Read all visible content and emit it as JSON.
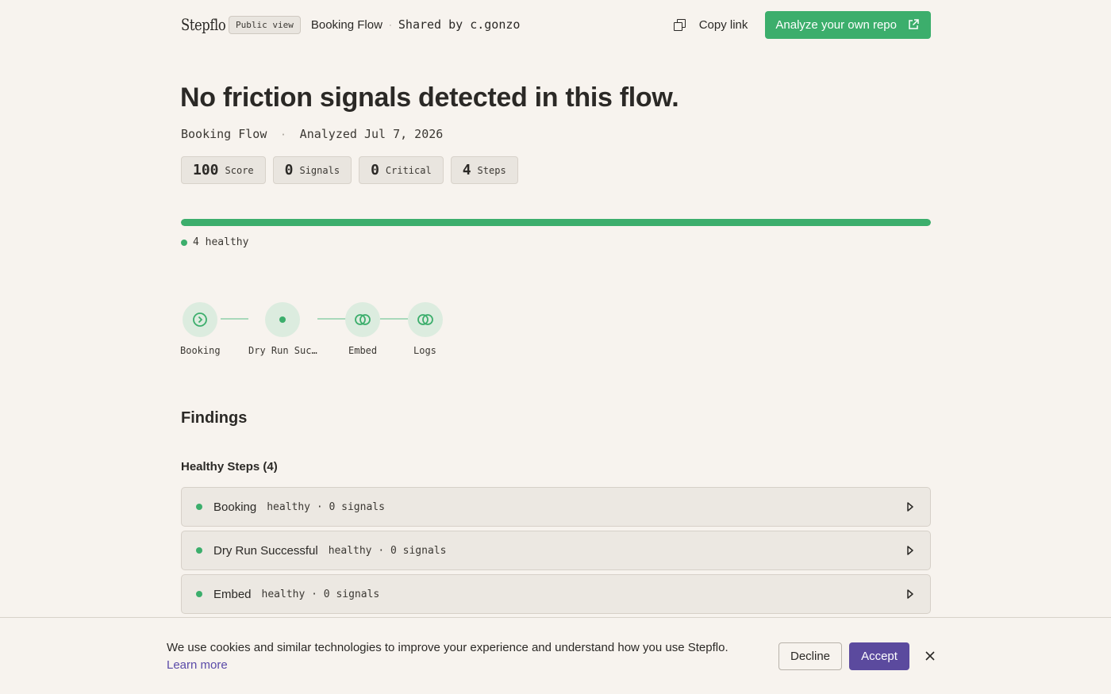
{
  "header": {
    "logo": "Stepflo",
    "badge": "Public view",
    "flow_name": "Booking Flow",
    "separator": "·",
    "shared_by": "Shared by c.gonzo",
    "copy_link": "Copy link",
    "analyze_button": "Analyze your own repo"
  },
  "hero": {
    "title": "No friction signals detected in this flow.",
    "flow_name": "Booking Flow",
    "analyzed": "Analyzed Jul 7, 2026"
  },
  "stats": [
    {
      "value": "100",
      "label": "Score"
    },
    {
      "value": "0",
      "label": "Signals"
    },
    {
      "value": "0",
      "label": "Critical"
    },
    {
      "value": "4",
      "label": "Steps"
    }
  ],
  "progress": {
    "healthy_fraction": 1.0,
    "legend": "4 healthy"
  },
  "steps": [
    {
      "label": "Booking",
      "icon": "arrow-circle-icon"
    },
    {
      "label": "Dry Run Suc…",
      "icon": "dot-icon"
    },
    {
      "label": "Embed",
      "icon": "rings-icon"
    },
    {
      "label": "Logs",
      "icon": "rings-icon"
    }
  ],
  "findings": {
    "title": "Findings",
    "healthy_title": "Healthy Steps (4)",
    "rows": [
      {
        "name": "Booking",
        "meta": "healthy · 0 signals"
      },
      {
        "name": "Dry Run Successful",
        "meta": "healthy · 0 signals"
      },
      {
        "name": "Embed",
        "meta": "healthy · 0 signals"
      }
    ]
  },
  "cookie": {
    "text": "We use cookies and similar technologies to improve your experience and understand how you use Stepflo.",
    "learn_more": "Learn more",
    "decline": "Decline",
    "accept": "Accept"
  },
  "colors": {
    "accent_green": "#3cae6c",
    "accent_purple": "#5b4a9e",
    "background": "#f7f3ee"
  }
}
